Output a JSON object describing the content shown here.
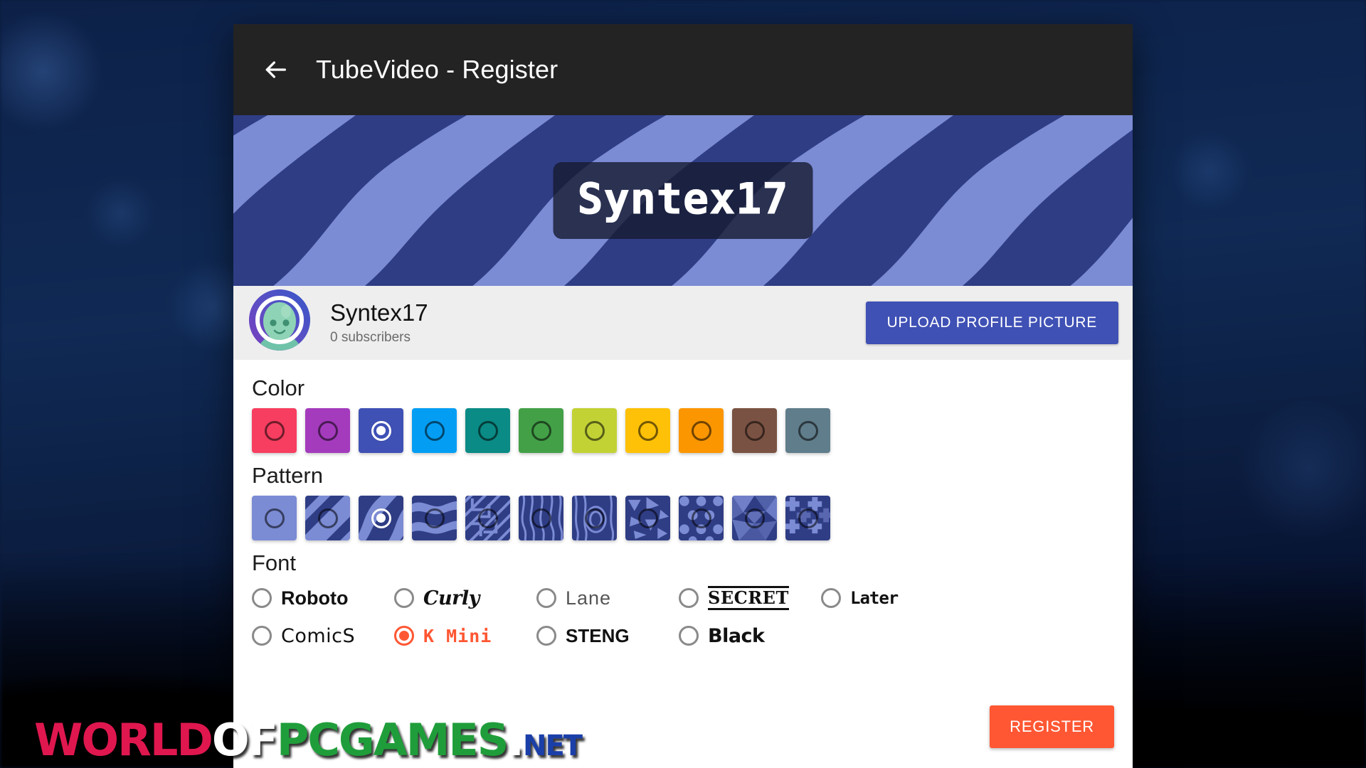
{
  "appbar": {
    "back_icon": "arrow-left-icon",
    "title": "TubeVideo - Register"
  },
  "banner": {
    "channel_name": "Syntex17",
    "pattern": "diagonal-waves",
    "colors": {
      "dark": "#2f3d85",
      "light": "#7b8bd4"
    }
  },
  "profile": {
    "avatar_icon": "alien-avatar",
    "name": "Syntex17",
    "subscribers": "0 subscribers",
    "upload_button": "UPLOAD PROFILE PICTURE",
    "upload_button_color": "#3f51b5"
  },
  "sections": {
    "color_title": "Color",
    "pattern_title": "Pattern",
    "font_title": "Font"
  },
  "colors": {
    "selected_index": 2,
    "swatches": [
      {
        "name": "pink",
        "hex": "#f73e60"
      },
      {
        "name": "purple",
        "hex": "#a43bbd"
      },
      {
        "name": "indigo",
        "hex": "#3f51b5"
      },
      {
        "name": "light-blue",
        "hex": "#039ef4"
      },
      {
        "name": "teal",
        "hex": "#0b8b85"
      },
      {
        "name": "green",
        "hex": "#43a047"
      },
      {
        "name": "lime",
        "hex": "#c2d235"
      },
      {
        "name": "amber",
        "hex": "#ffc107"
      },
      {
        "name": "orange",
        "hex": "#fb9600"
      },
      {
        "name": "brown",
        "hex": "#7a5243"
      },
      {
        "name": "blue-grey",
        "hex": "#607d8b"
      }
    ]
  },
  "patterns": {
    "selected_index": 2,
    "base_dark": "#2f3d85",
    "base_light": "#7b8bd4",
    "swatches": [
      {
        "name": "solid"
      },
      {
        "name": "diagonal-stripes"
      },
      {
        "name": "waves"
      },
      {
        "name": "horizontal-waves"
      },
      {
        "name": "maze"
      },
      {
        "name": "wood-grain"
      },
      {
        "name": "wood-rings"
      },
      {
        "name": "triangles"
      },
      {
        "name": "polka-dots"
      },
      {
        "name": "low-poly"
      },
      {
        "name": "crosses"
      }
    ]
  },
  "fonts": {
    "selected": "K Mini",
    "options": [
      {
        "label": "Roboto",
        "style": "f-roboto",
        "selected": false
      },
      {
        "label": "Curly",
        "style": "f-curly",
        "selected": false
      },
      {
        "label": "Lane",
        "style": "f-lane",
        "selected": false
      },
      {
        "label": "SECRET",
        "style": "f-secret",
        "selected": false
      },
      {
        "label": "Later",
        "style": "f-later",
        "selected": false
      },
      {
        "label": "ComicS",
        "style": "f-comics",
        "selected": false
      },
      {
        "label": "K Mini",
        "style": "f-kmini",
        "selected": true
      },
      {
        "label": "STENG",
        "style": "f-steng",
        "selected": false
      },
      {
        "label": "Black",
        "style": "f-black",
        "selected": false
      }
    ]
  },
  "register_button": {
    "label": "REGISTER",
    "color": "#ff5733"
  },
  "watermark": {
    "part1": "WORLD",
    "part2": "OF",
    "part3": "PCGAMES",
    "dot": ".",
    "part4": "NET"
  }
}
